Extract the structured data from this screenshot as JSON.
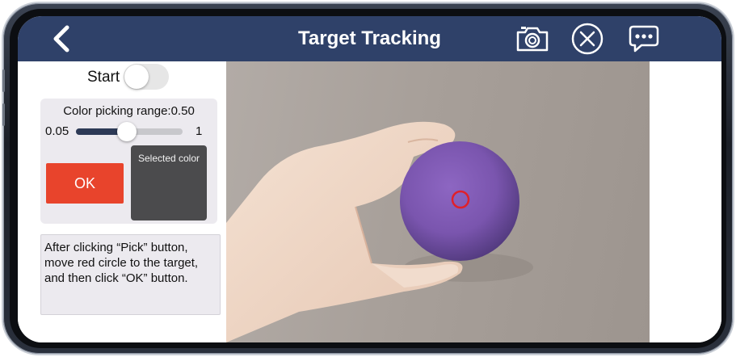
{
  "header": {
    "title": "Target Tracking",
    "back_icon": "chevron-left-icon",
    "camera_icon": "camera-icon",
    "close_icon": "close-circle-icon",
    "chat_icon": "chat-bubble-icon",
    "background_color": "#2f4169"
  },
  "controls": {
    "start_label": "Start",
    "start_toggle_on": false,
    "color_picking_range_label": "Color picking range:0.50",
    "slider_min_label": "0.05",
    "slider_max_label": "1",
    "slider_value": 0.5,
    "ok_label": "OK",
    "ok_color": "#e8442c",
    "selected_color_label": "Selected color",
    "selected_color_swatch": "#4b4b4d"
  },
  "instructions": "After clicking “Pick” button, move red circle to the target, and then click “OK” button.",
  "camera_view": {
    "target_marker_color": "#e0202a",
    "ball_color": "#7f5ab0"
  }
}
